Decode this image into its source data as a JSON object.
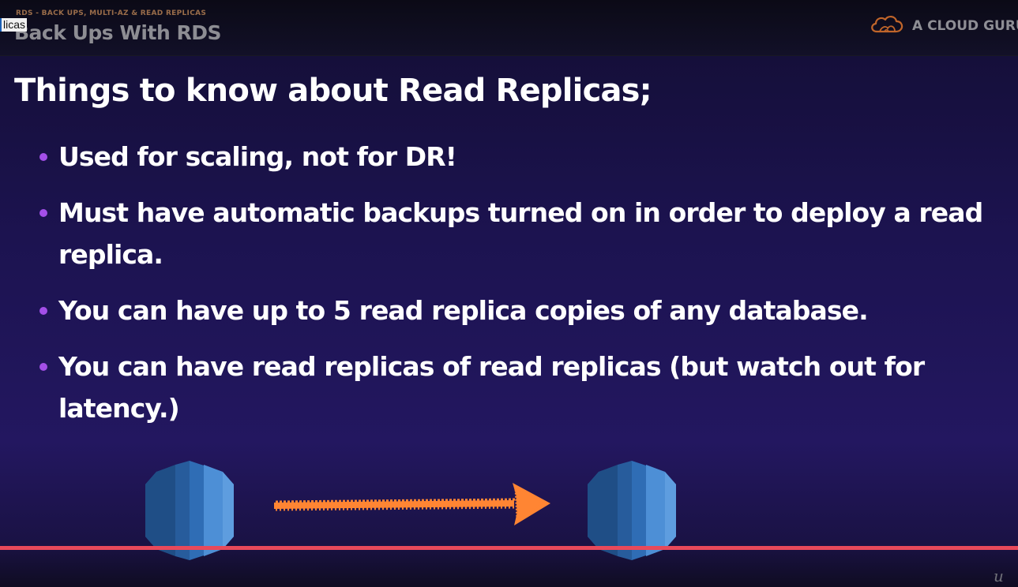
{
  "header": {
    "section_label": "RDS - BACK UPS, MULTI-AZ & READ REPLICAS",
    "slide_title": "Back Ups With RDS",
    "tooltip_text": "licas"
  },
  "brand": {
    "name": "A CLOUD GURU",
    "icon": "cloud-logo-icon"
  },
  "slide": {
    "heading": "Things to know about Read Replicas;",
    "bullets": [
      "Used for scaling, not for DR!",
      "Must have automatic backups turned on in order to deploy a read replica.",
      "You can have up to 5 read replica copies of any database.",
      "You can have read replicas of read replicas (but watch out for latency.)"
    ]
  },
  "diagram": {
    "source_icon": "rds-database-icon",
    "target_icon": "rds-database-icon",
    "connector_icon": "right-arrow-icon"
  },
  "player": {
    "progress_fraction": 1.0,
    "watermark_text": "u"
  },
  "colors": {
    "background": "#1c1350",
    "bullet_dot": "#a34fe8",
    "arrow": "#ff8533",
    "database_blue": "#2f6db5",
    "progress_bar": "#e8495a"
  }
}
